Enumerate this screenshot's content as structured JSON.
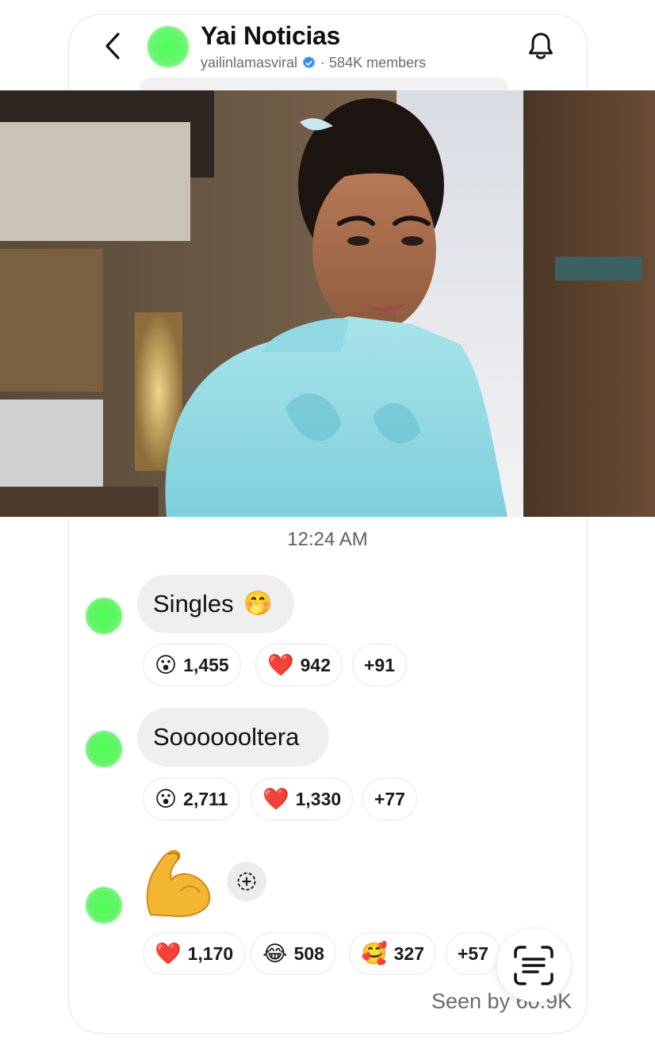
{
  "header": {
    "title": "Yai Noticias",
    "handle": "yailinlamasviral",
    "separator": "·",
    "members": "584K members"
  },
  "post": {
    "image_description_icon": "photo",
    "timestamp": "12:24 AM"
  },
  "messages": [
    {
      "text": "Singles",
      "emoji": "🤭",
      "reactions": [
        {
          "emoji": "😮",
          "count": "1,455"
        },
        {
          "emoji": "❤️",
          "count": "942"
        },
        {
          "emoji": "",
          "count": "+91"
        }
      ]
    },
    {
      "text": "Sooooooltera",
      "emoji": "",
      "reactions": [
        {
          "emoji": "😮",
          "count": "2,711"
        },
        {
          "emoji": "❤️",
          "count": "1,330"
        },
        {
          "emoji": "",
          "count": "+77"
        }
      ]
    },
    {
      "text": "",
      "emoji": "💪",
      "reactions": [
        {
          "emoji": "❤️",
          "count": "1,170"
        },
        {
          "emoji": "😂",
          "count": "508"
        },
        {
          "emoji": "🥰",
          "count": "327"
        },
        {
          "emoji": "",
          "count": "+57"
        }
      ]
    }
  ],
  "footer": {
    "seen": "Seen by 60.9K"
  },
  "colors": {
    "avatar_green": "#4cff55",
    "verified_blue": "#2f8df5",
    "bubble_bg": "#efeff2"
  }
}
